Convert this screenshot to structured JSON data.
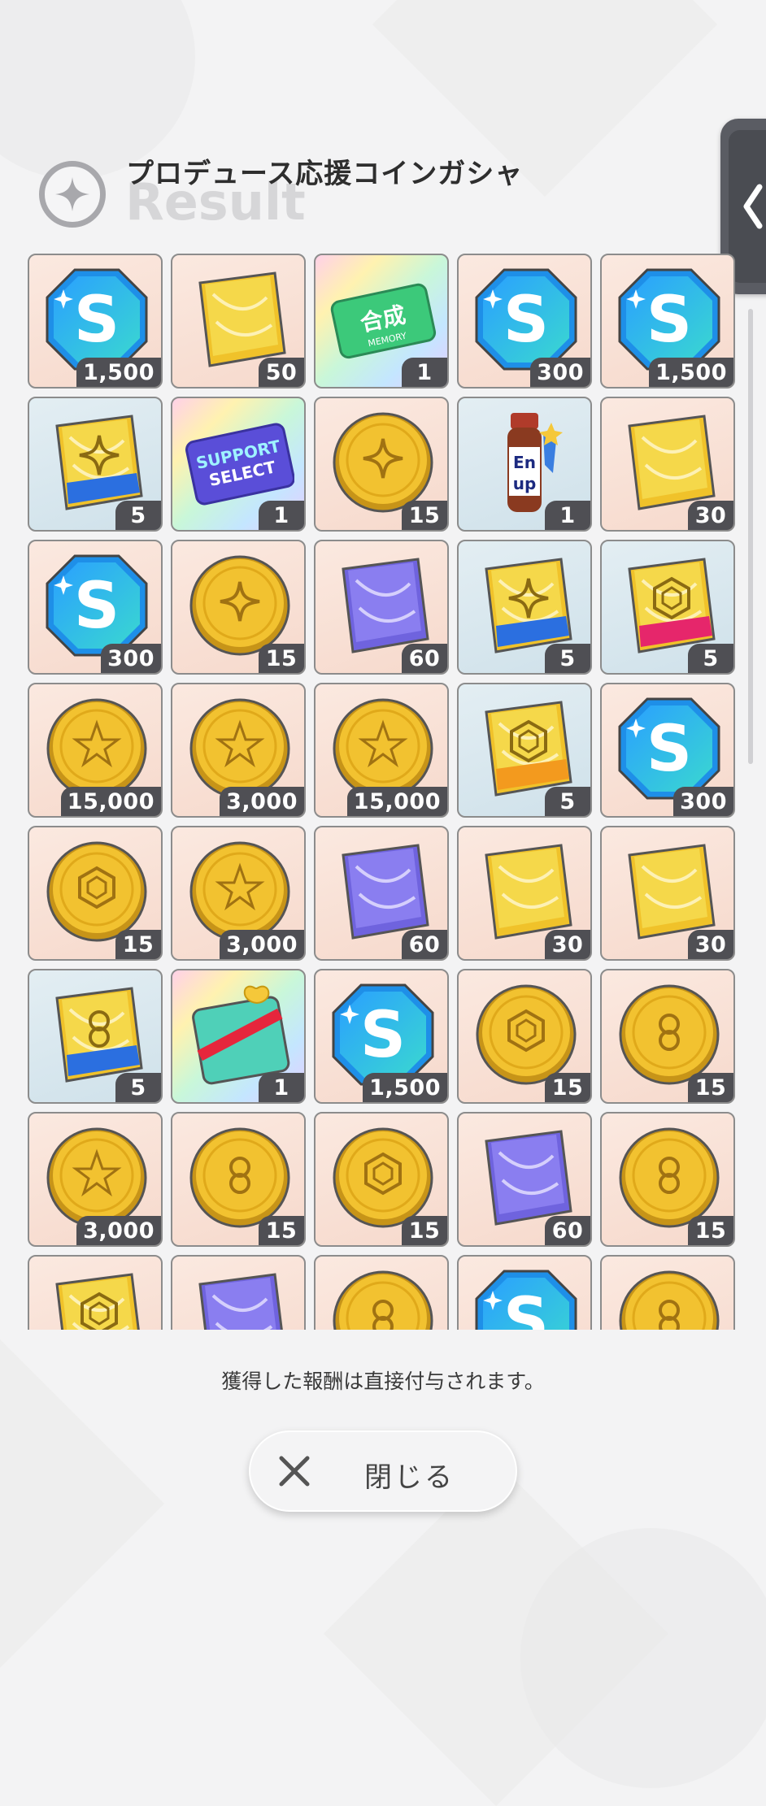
{
  "header": {
    "title": "プロデュース応援コインガシャ",
    "subtitle": "Result"
  },
  "items": [
    {
      "kind": "s-gem",
      "count": "1,500"
    },
    {
      "kind": "book-yellow",
      "count": "50"
    },
    {
      "kind": "card-merge",
      "count": "1",
      "label": "合成",
      "sublabel": "MEMORY"
    },
    {
      "kind": "s-gem",
      "count": "300"
    },
    {
      "kind": "s-gem",
      "count": "1,500"
    },
    {
      "kind": "book-blue-sparkle",
      "count": "5"
    },
    {
      "kind": "card-support",
      "count": "1",
      "label": "SUPPORT SELECT"
    },
    {
      "kind": "coin-sparkle",
      "count": "15"
    },
    {
      "kind": "energy-bottle",
      "count": "1",
      "label": "En up"
    },
    {
      "kind": "book-yellow",
      "count": "30"
    },
    {
      "kind": "s-gem",
      "count": "300"
    },
    {
      "kind": "coin-sparkle",
      "count": "15"
    },
    {
      "kind": "book-purple",
      "count": "60"
    },
    {
      "kind": "book-blue-sparkle",
      "count": "5"
    },
    {
      "kind": "book-pink-hex",
      "count": "5"
    },
    {
      "kind": "coin-star",
      "count": "15,000"
    },
    {
      "kind": "coin-star",
      "count": "3,000"
    },
    {
      "kind": "coin-star",
      "count": "15,000"
    },
    {
      "kind": "book-orange-hex",
      "count": "5"
    },
    {
      "kind": "s-gem",
      "count": "300"
    },
    {
      "kind": "coin-hex",
      "count": "15"
    },
    {
      "kind": "coin-star",
      "count": "3,000"
    },
    {
      "kind": "book-purple",
      "count": "60"
    },
    {
      "kind": "book-yellow",
      "count": "30"
    },
    {
      "kind": "book-yellow",
      "count": "30"
    },
    {
      "kind": "book-blue-swirl",
      "count": "5"
    },
    {
      "kind": "gift-card",
      "count": "1"
    },
    {
      "kind": "s-gem",
      "count": "1,500"
    },
    {
      "kind": "coin-hex",
      "count": "15"
    },
    {
      "kind": "coin-swirl",
      "count": "15"
    },
    {
      "kind": "coin-star",
      "count": "3,000"
    },
    {
      "kind": "coin-swirl",
      "count": "15"
    },
    {
      "kind": "coin-hex",
      "count": "15"
    },
    {
      "kind": "book-purple",
      "count": "60"
    },
    {
      "kind": "coin-swirl",
      "count": "15"
    },
    {
      "kind": "book-yellow-hex",
      "count": ""
    },
    {
      "kind": "book-purple",
      "count": ""
    },
    {
      "kind": "coin-swirl",
      "count": ""
    },
    {
      "kind": "s-gem",
      "count": ""
    },
    {
      "kind": "coin-swirl",
      "count": ""
    }
  ],
  "footer": {
    "notice": "獲得した報酬は直接付与されます。",
    "close_label": "閉じる"
  },
  "colors": {
    "count_badge": "#4f4f54",
    "gem_blue": "#1e8fe8",
    "coin_gold": "#f2c230",
    "book_yellow": "#f5d84a",
    "book_purple": "#8a7ef0"
  }
}
